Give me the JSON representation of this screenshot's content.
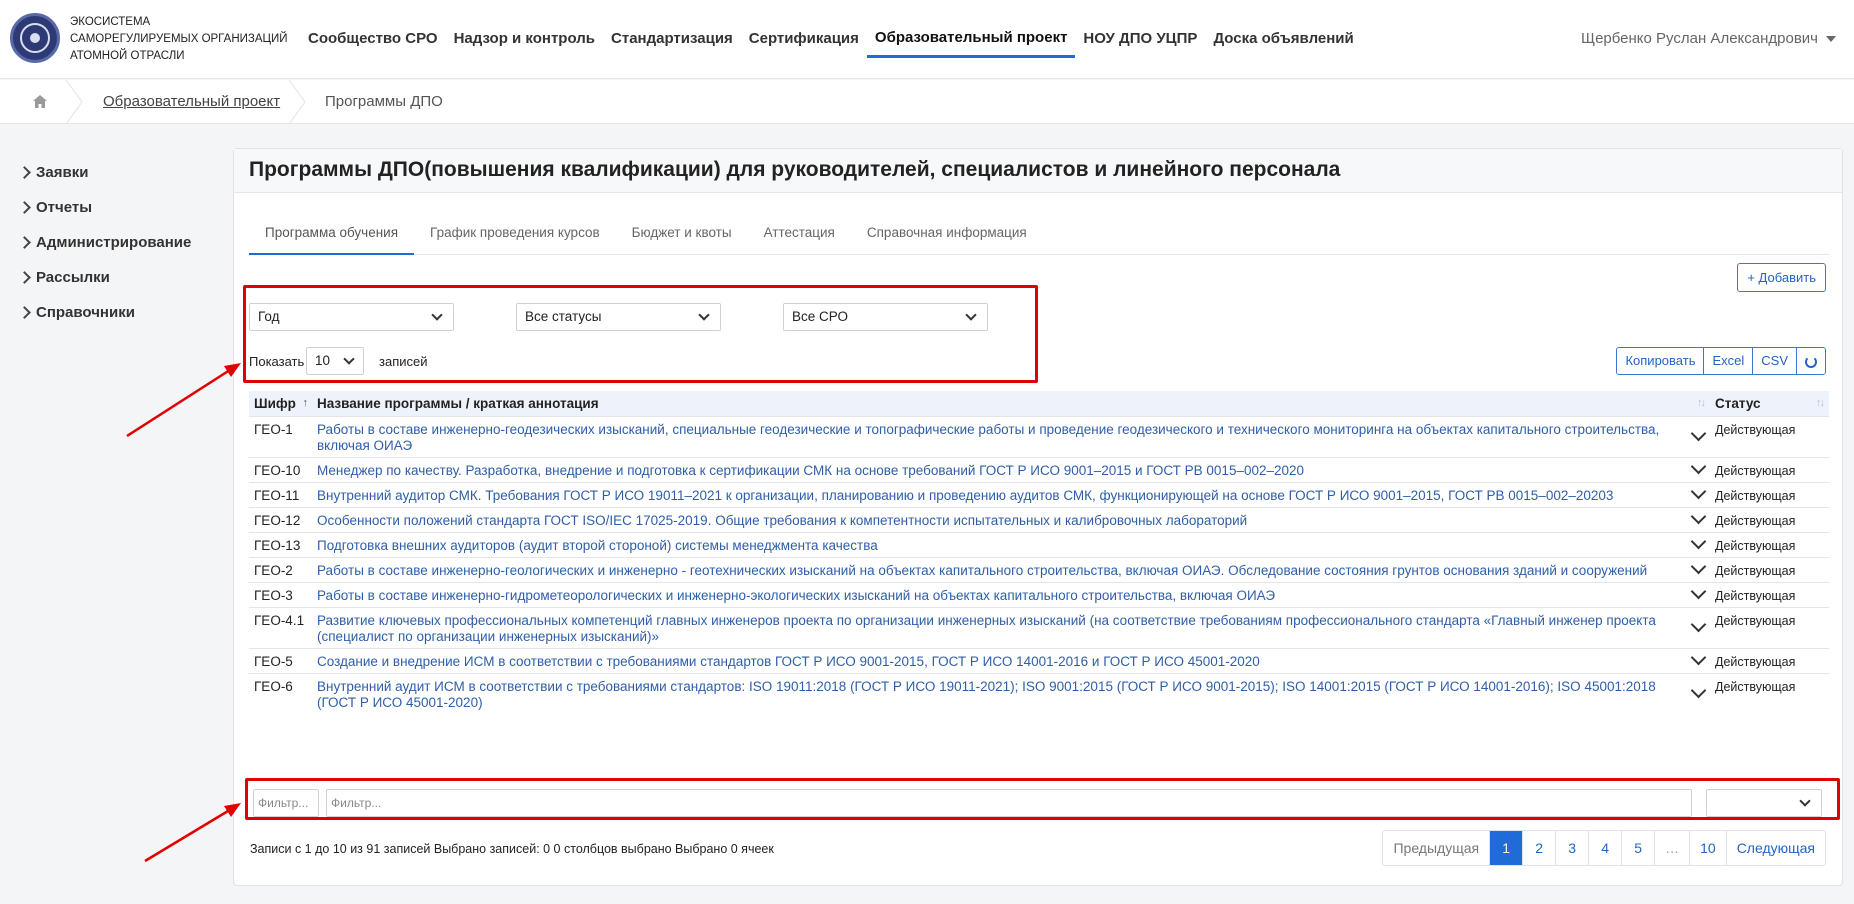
{
  "header": {
    "brand_lines": [
      "Экосистема",
      "саморегулируемых организаций",
      "атомной отрасли"
    ],
    "nav": [
      {
        "label": "Сообщество СРО",
        "active": false
      },
      {
        "label": "Надзор и контроль",
        "active": false
      },
      {
        "label": "Стандартизация",
        "active": false
      },
      {
        "label": "Сертификация",
        "active": false
      },
      {
        "label": "Образовательный проект",
        "active": true
      },
      {
        "label": "НОУ ДПО УЦПР",
        "active": false
      },
      {
        "label": "Доска объявлений",
        "active": false
      }
    ],
    "user_name": "Щербенко Руслан Александрович",
    "accent_color": "#1f6cd8"
  },
  "breadcrumb": {
    "home_icon": "home-icon",
    "parent": "Образовательный проект",
    "current": "Программы ДПО"
  },
  "sidebar": {
    "items": [
      {
        "label": "Заявки"
      },
      {
        "label": "Отчеты"
      },
      {
        "label": "Администрирование"
      },
      {
        "label": "Рассылки"
      },
      {
        "label": "Справочники"
      }
    ]
  },
  "main": {
    "title": "Программы ДПО(повышения квалификации) для руководителей, специалистов и линейного персонала",
    "tabs": [
      {
        "label": "Программа обучения",
        "active": true
      },
      {
        "label": "График проведения курсов",
        "active": false
      },
      {
        "label": "Бюджет и квоты",
        "active": false
      },
      {
        "label": "Аттестация",
        "active": false
      },
      {
        "label": "Справочная информация",
        "active": false
      }
    ],
    "add_button": "+ Добавить",
    "filters": {
      "year": "Год",
      "status": "Все статусы",
      "sro": "Все СРО"
    },
    "page_size": {
      "prefix": "Показать",
      "value": "10",
      "suffix": "записей"
    },
    "export_buttons": [
      "Копировать",
      "Excel",
      "CSV"
    ],
    "reload_icon": "reload-icon"
  },
  "table": {
    "columns": [
      "Шифр",
      "Название программы / краткая аннотация",
      "Статус"
    ],
    "rows": [
      {
        "code": "ГЕО-1",
        "name": "Работы в составе инженерно-геодезических изысканий, специальные геодезические и топографические работы и проведение геодезического и технического мониторинга на объектах капитального строительства, включая ОИАЭ",
        "status": "Действующая"
      },
      {
        "code": "ГЕО-10",
        "name": "Менеджер по качеству. Разработка, внедрение и подготовка к сертификации СМК на основе требований ГОСТ Р ИСО 9001–2015 и ГОСТ РВ 0015–002–2020",
        "status": "Действующая"
      },
      {
        "code": "ГЕО-11",
        "name": "Внутренний аудитор СМК. Требования ГОСТ Р ИСО 19011–2021 к организации, планированию и проведению аудитов СМК, функционирующей на основе ГОСТ Р ИСО 9001–2015, ГОСТ РВ 0015–002–20203",
        "status": "Действующая"
      },
      {
        "code": "ГЕО-12",
        "name": "Особенности положений стандарта ГОСТ ISO/IEC 17025-2019. Общие требования к компетентности испытательных и калибровочных лабораторий",
        "status": "Действующая"
      },
      {
        "code": "ГЕО-13",
        "name": "Подготовка внешних аудиторов (аудит второй стороной) системы менеджмента качества",
        "status": "Действующая"
      },
      {
        "code": "ГЕО-2",
        "name": "Работы в составе инженерно-геологических и инженерно - геотехнических изысканий на объектах капитального строительства, включая ОИАЭ. Обследование состояния грунтов основания зданий и сооружений",
        "status": "Действующая"
      },
      {
        "code": "ГЕО-3",
        "name": "Работы в составе инженерно-гидрометеорологических и инженерно-экологических изысканий на объектах капитального строительства, включая ОИАЭ",
        "status": "Действующая"
      },
      {
        "code": "ГЕО-4.1",
        "name": "Развитие ключевых профессиональных компетенций главных инженеров проекта по организации инженерных изысканий (на соответствие требованиям профессионального стандарта «Главный инженер проекта (специалист по организации инженерных изысканий)»",
        "status": "Действующая"
      },
      {
        "code": "ГЕО-5",
        "name": "Создание и внедрение ИСМ в соответствии с требованиями стандартов ГОСТ Р ИСО 9001-2015, ГОСТ Р ИСО 14001-2016 и ГОСТ Р ИСО 45001-2020",
        "status": "Действующая"
      },
      {
        "code": "ГЕО-6",
        "name": "Внутренний аудит ИСМ в соответствии с требованиями стандартов: ISO 19011:2018 (ГОСТ Р ИСО 19011-2021); ISO 9001:2015 (ГОСТ Р ИСО 9001-2015); ISO 14001:2015 (ГОСТ Р ИСО 14001-2016); ISO 45001:2018 (ГОСТ Р ИСО 45001-2020)",
        "status": "Действующая"
      }
    ],
    "filter_placeholder_code": "Фильтр...",
    "filter_placeholder_name": "Фильтр...",
    "status_filter_value": ""
  },
  "footer": {
    "info": "Записи с 1 до 10 из 91 записей    Выбрано записей: 0   0 столбцов выбрано   Выбрано 0 ячеек",
    "pagination": {
      "prev": "Предыдущая",
      "pages": [
        "1",
        "2",
        "3",
        "4",
        "5",
        "…",
        "10"
      ],
      "active_page": "1",
      "next": "Следующая"
    }
  },
  "annotations": {
    "highlight_color": "#e10000"
  }
}
